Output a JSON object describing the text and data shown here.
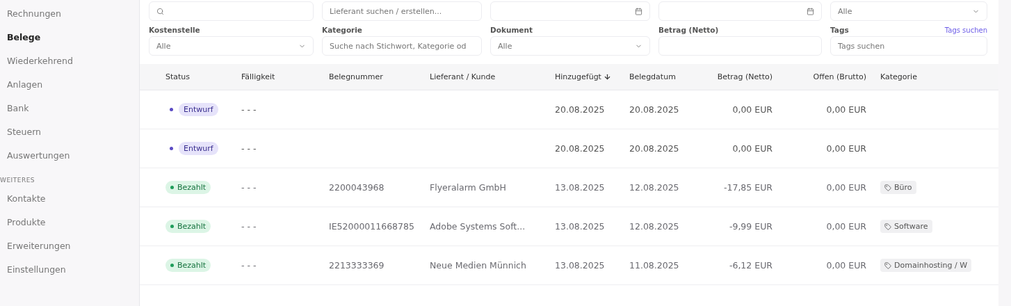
{
  "sidebar": {
    "items": [
      {
        "label": "Rechnungen",
        "selected": false
      },
      {
        "label": "Belege",
        "selected": true
      },
      {
        "label": "Wiederkehrend",
        "selected": false
      },
      {
        "label": "Anlagen",
        "selected": false
      },
      {
        "label": "Bank",
        "selected": false
      },
      {
        "label": "Steuern",
        "selected": false
      },
      {
        "label": "Auswertungen",
        "selected": false
      }
    ],
    "section_label": "WEITERES",
    "section_items": [
      {
        "label": "Kontakte",
        "selected": false
      },
      {
        "label": "Produkte",
        "selected": false
      },
      {
        "label": "Erweiterungen",
        "selected": false
      },
      {
        "label": "Einstellungen",
        "selected": false
      }
    ]
  },
  "filters": {
    "top_row": [
      {
        "kind": "search"
      },
      {
        "kind": "text",
        "placeholder": "Lieferant suchen / erstellen..."
      },
      {
        "kind": "date"
      },
      {
        "kind": "date"
      },
      {
        "kind": "select",
        "value": "Alle"
      }
    ],
    "fields": [
      {
        "label": "Kostenstelle",
        "kind": "select",
        "value": "Alle"
      },
      {
        "label": "Kategorie",
        "kind": "text",
        "placeholder": "Suche nach Stichwort, Kategorie od"
      },
      {
        "label": "Dokument",
        "kind": "select",
        "value": "Alle"
      },
      {
        "label": "Betrag (Netto)",
        "kind": "text"
      },
      {
        "label": "Tags",
        "kind": "tags",
        "link": "Tags suchen",
        "placeholder": "Tags suchen"
      }
    ]
  },
  "table": {
    "columns": [
      {
        "label": "Status",
        "sorted": false
      },
      {
        "label": "Fälligkeit",
        "sorted": false
      },
      {
        "label": "Belegnummer",
        "sorted": false
      },
      {
        "label": "Lieferant / Kunde",
        "sorted": false
      },
      {
        "label": "Hinzugefügt",
        "sorted": true
      },
      {
        "label": "Belegdatum",
        "sorted": false
      },
      {
        "label": "Betrag (Netto)",
        "sorted": false
      },
      {
        "label": "Offen (Brutto)",
        "sorted": false
      },
      {
        "label": "Kategorie",
        "sorted": false
      }
    ],
    "rows": [
      {
        "highlighted": true,
        "status": {
          "kind": "draft",
          "label": "Entwurf"
        },
        "due": "- - -",
        "number": "",
        "party": "",
        "added": "20.08.2025",
        "date": "20.08.2025",
        "net": "0,00 EUR",
        "open": "0,00 EUR",
        "category": ""
      },
      {
        "highlighted": true,
        "status": {
          "kind": "draft",
          "label": "Entwurf"
        },
        "due": "- - -",
        "number": "",
        "party": "",
        "added": "20.08.2025",
        "date": "20.08.2025",
        "net": "0,00 EUR",
        "open": "0,00 EUR",
        "category": ""
      },
      {
        "highlighted": false,
        "status": {
          "kind": "paid",
          "label": "Bezahlt"
        },
        "due": "- - -",
        "number": "2200043968",
        "party": "Flyeralarm GmbH",
        "added": "13.08.2025",
        "date": "12.08.2025",
        "net": "-17,85 EUR",
        "open": "0,00 EUR",
        "category": "Büro"
      },
      {
        "highlighted": false,
        "status": {
          "kind": "paid",
          "label": "Bezahlt"
        },
        "due": "- - -",
        "number": "IE52000011668785",
        "party": "Adobe Systems Soft...",
        "added": "13.08.2025",
        "date": "12.08.2025",
        "net": "-9,99 EUR",
        "open": "0,00 EUR",
        "category": "Software"
      },
      {
        "highlighted": false,
        "status": {
          "kind": "paid",
          "label": "Bezahlt"
        },
        "due": "- - -",
        "number": "2213333369",
        "party": "Neue Medien Münnich",
        "added": "13.08.2025",
        "date": "11.08.2025",
        "net": "-6,12 EUR",
        "open": "0,00 EUR",
        "category": "Domainhosting / W"
      }
    ]
  }
}
